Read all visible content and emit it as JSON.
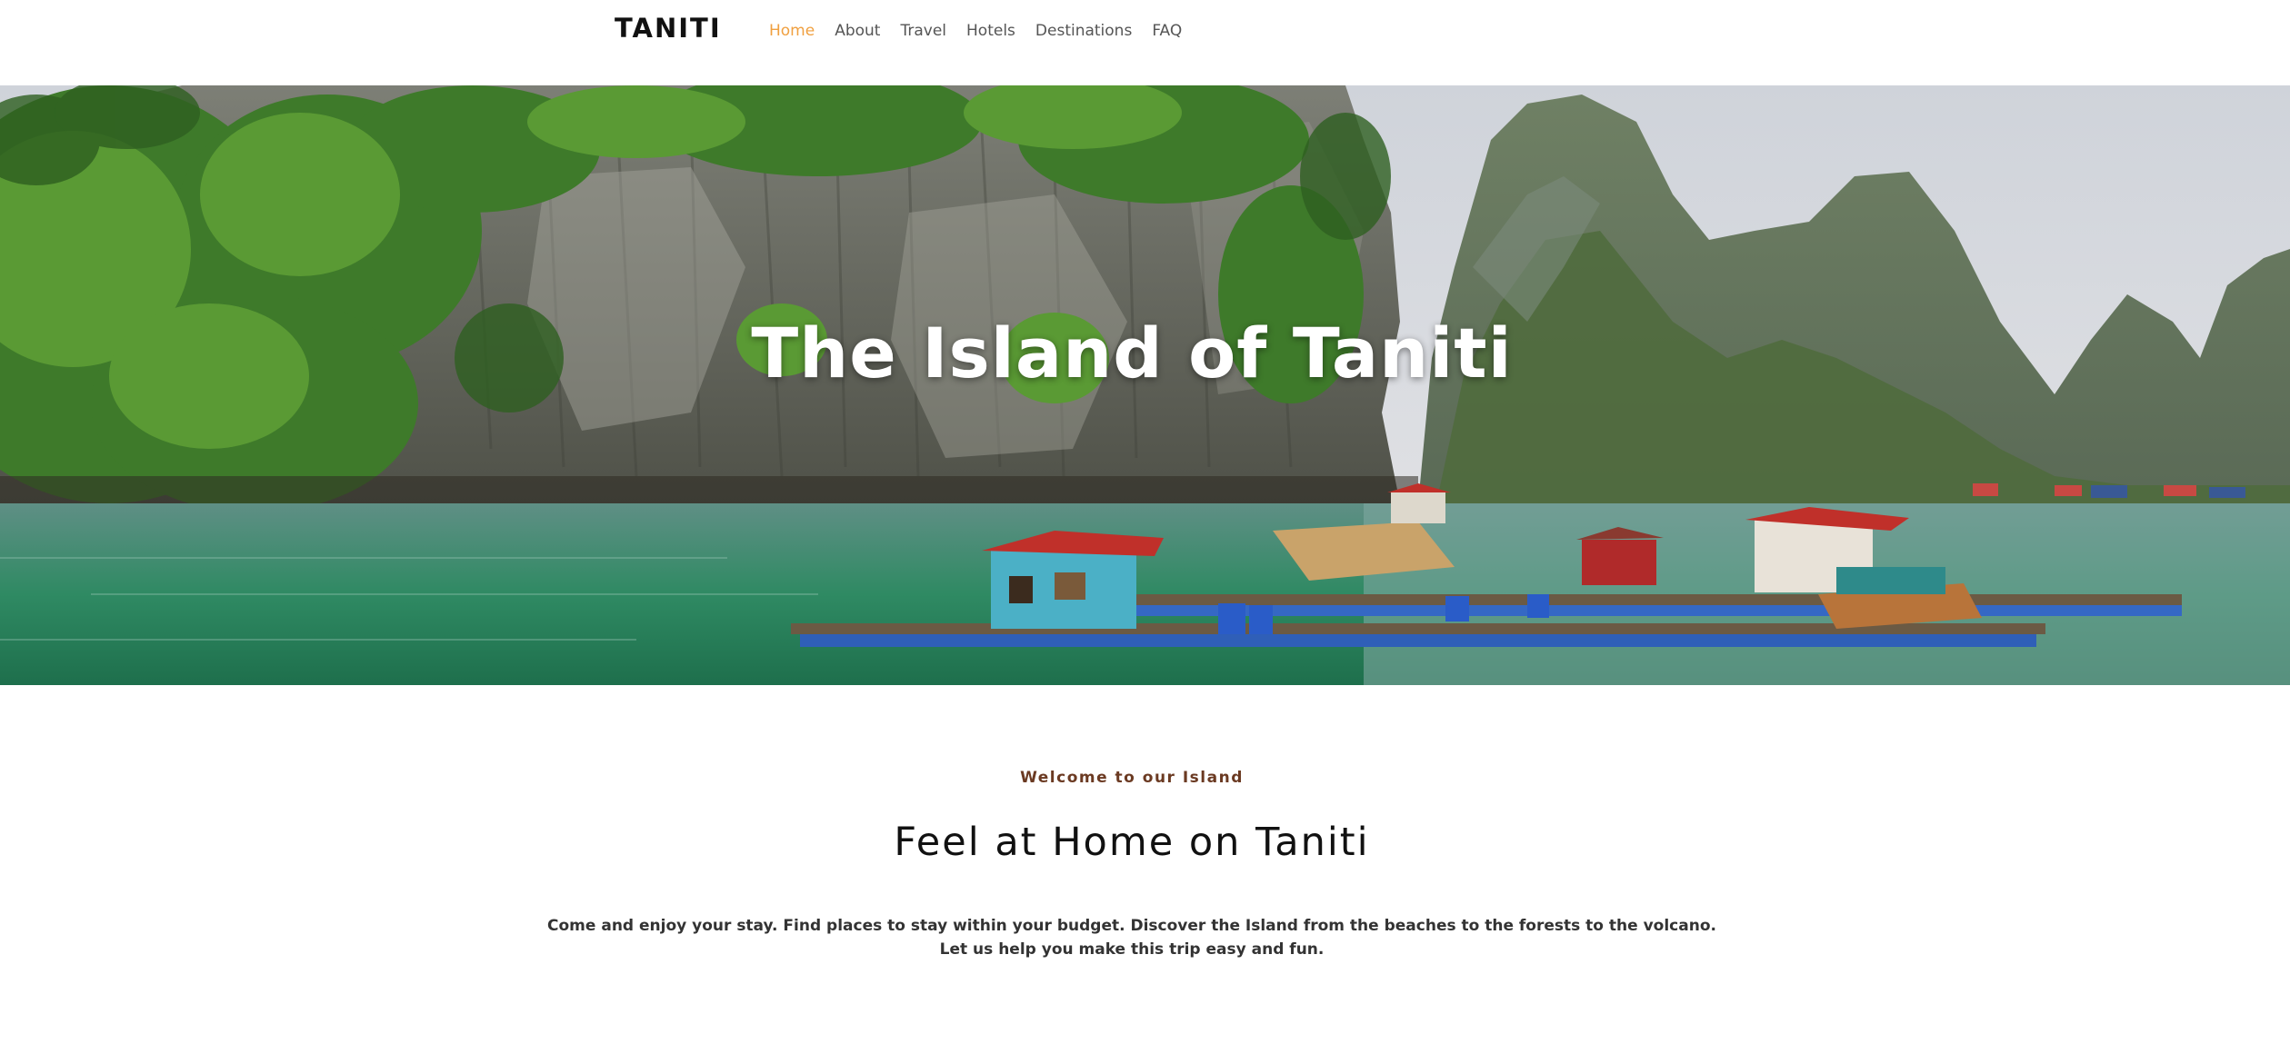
{
  "header": {
    "brand": "TANITI",
    "nav": [
      {
        "label": "Home",
        "active": true
      },
      {
        "label": "About",
        "active": false
      },
      {
        "label": "Travel",
        "active": false
      },
      {
        "label": "Hotels",
        "active": false
      },
      {
        "label": "Destinations",
        "active": false
      },
      {
        "label": "FAQ",
        "active": false
      }
    ],
    "active_color": "#f0a040"
  },
  "hero": {
    "title": "The Island of Taniti",
    "image": "karst-islands-floating-village-photo"
  },
  "welcome": {
    "eyebrow": "Welcome to our Island",
    "title": "Feel at Home on Taniti",
    "intro_line_1": "Come and enjoy your stay. Find places to stay within your budget. Discover the Island from the beaches to the forests to the volcano.",
    "intro_line_2": "Let us help you make this trip easy and fun."
  },
  "colors": {
    "eyebrow": "#6b3a22",
    "title": "#111111",
    "body_text": "#333333"
  }
}
